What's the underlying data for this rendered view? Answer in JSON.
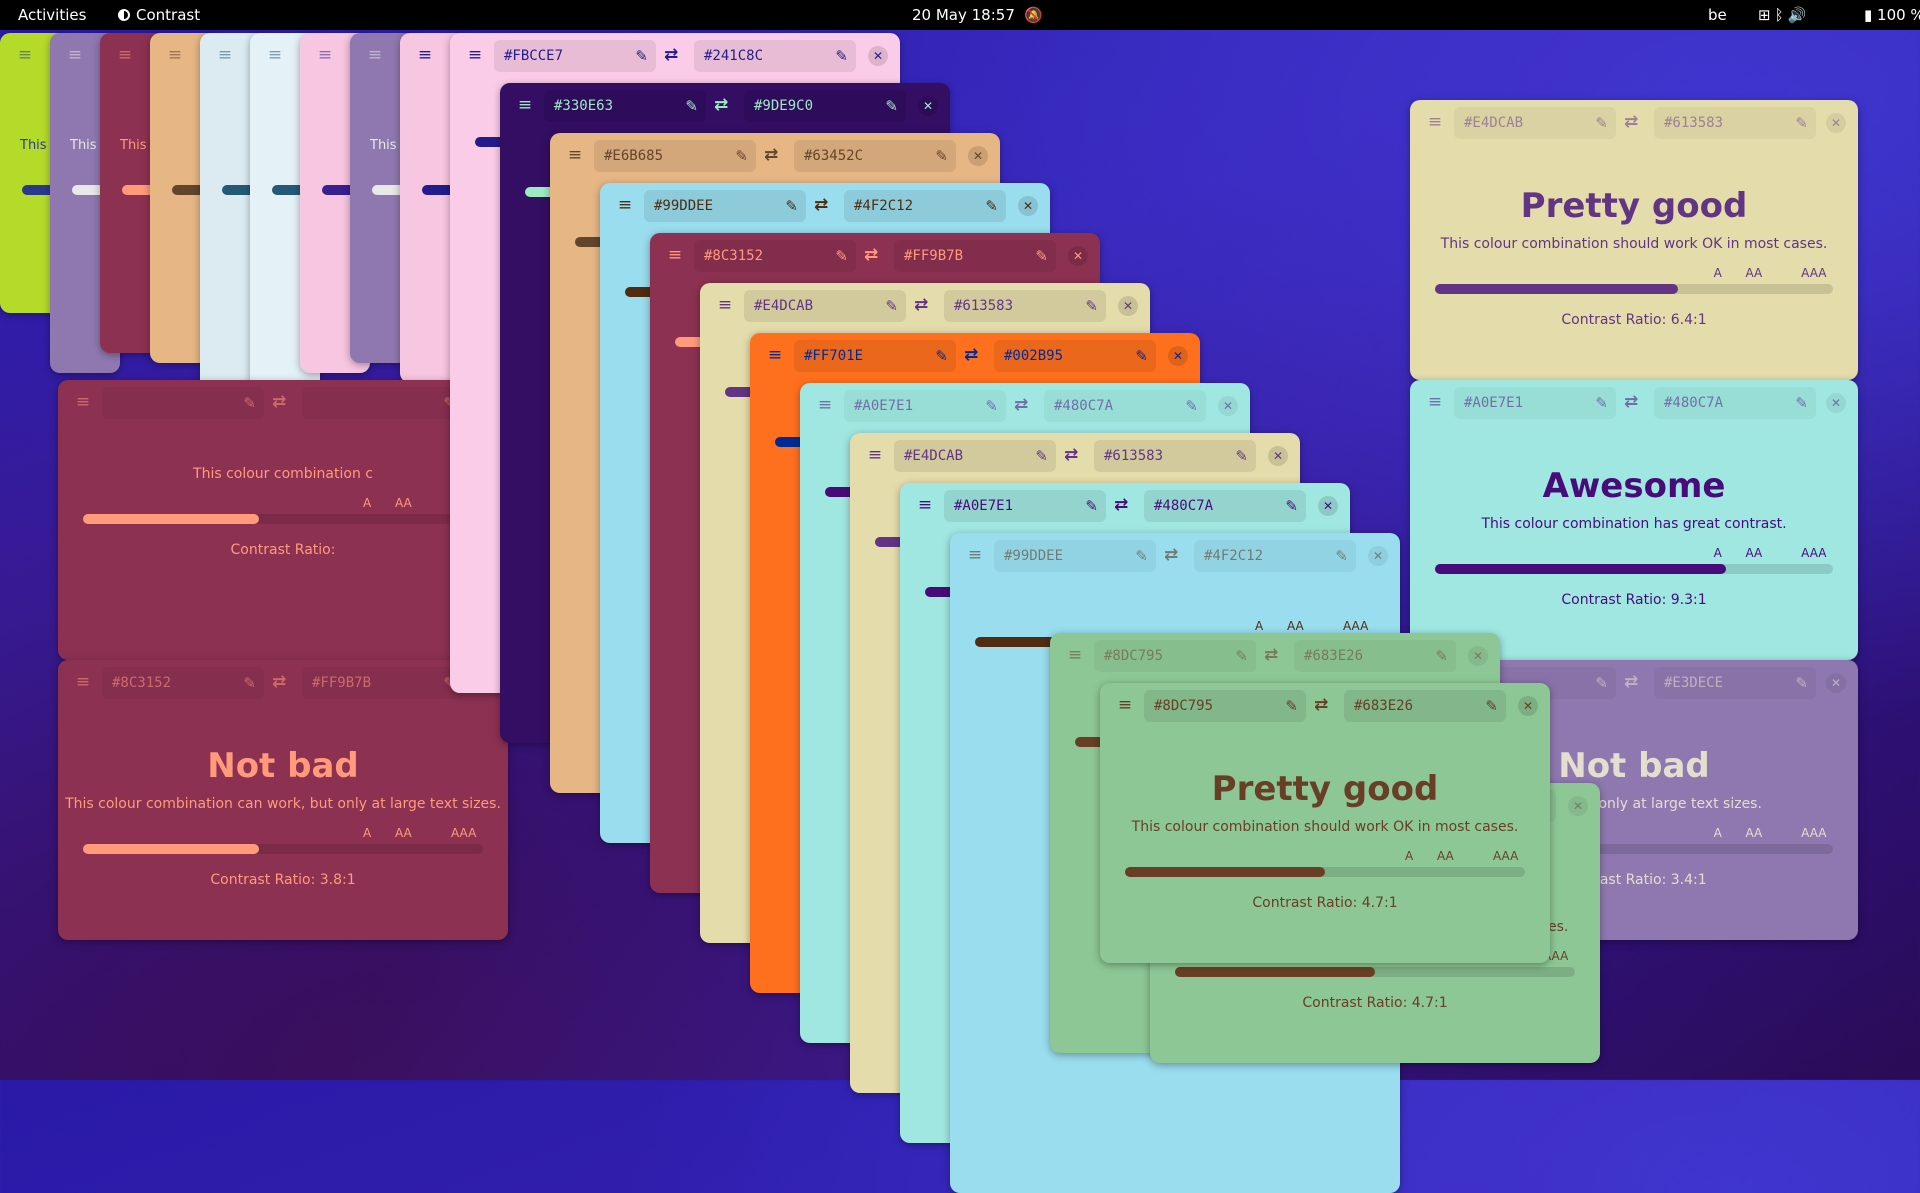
{
  "topbar": {
    "activities": "Activities",
    "app_name": "Contrast",
    "datetime": "20 May 18:57",
    "keyboard_layout": "be",
    "battery": "100 %",
    "icons": [
      "network-icon",
      "bluetooth-icon",
      "volume-icon",
      "battery-icon",
      "notifications-off-icon"
    ]
  },
  "ui": {
    "menu_icon": "≡",
    "swap_icon": "⇄",
    "picker_icon": "✎",
    "close_icon": "✕",
    "level_a": "A",
    "level_aa": "AA",
    "level_aaa": "AAA",
    "stub_text": "This"
  },
  "windows": [
    {
      "bg": "#B5DB2A",
      "fg": "#2A3A8A",
      "fg_hex": "",
      "bg_hex": "",
      "rating": "",
      "desc": "",
      "ratio": "",
      "level": 0.3,
      "dim": true,
      "stub": true
    },
    {
      "bg": "#8F78B0",
      "fg": "#E8E8E8",
      "fg_hex": "",
      "bg_hex": "",
      "rating": "",
      "desc": "",
      "ratio": "",
      "level": 0.3,
      "dim": true,
      "stub": true
    },
    {
      "bg": "#8C3152",
      "fg": "#FF9B7B",
      "fg_hex": "",
      "bg_hex": "",
      "rating": "",
      "desc": "",
      "ratio": "",
      "level": 0.3,
      "dim": true,
      "stub": true
    },
    {
      "bg": "#E6B685",
      "fg": "#63452C",
      "fg_hex": "",
      "bg_hex": "",
      "rating": "",
      "desc": "",
      "ratio": "",
      "level": 0.3,
      "dim": true,
      "stub": false
    },
    {
      "bg": "#DCEBF2",
      "fg": "#245A78",
      "fg_hex": "",
      "bg_hex": "",
      "rating": "",
      "desc": "",
      "ratio": "",
      "level": 0.3,
      "dim": true,
      "stub": false
    },
    {
      "bg": "#E4F2F8",
      "fg": "#245A78",
      "fg_hex": "",
      "bg_hex": "",
      "rating": "",
      "desc": "",
      "ratio": "",
      "level": 0.3,
      "dim": true,
      "stub": false
    },
    {
      "bg": "#F7C6E0",
      "fg": "#3A2090",
      "fg_hex": "",
      "bg_hex": "",
      "rating": "",
      "desc": "",
      "ratio": "",
      "level": 0.3,
      "dim": true,
      "stub": false
    },
    {
      "bg": "#8F78B0",
      "fg": "#E8E8E8",
      "fg_hex": "",
      "bg_hex": "",
      "rating": "",
      "desc": "",
      "ratio": "",
      "level": 0.3,
      "dim": true,
      "stub": true
    },
    {
      "bg": "#F7C6E0",
      "fg": "#241C8C",
      "fg_hex": "",
      "bg_hex": "",
      "rating": "",
      "desc": "",
      "ratio": "",
      "level": 0.3,
      "dim": false,
      "stub": false
    },
    {
      "bg": "#FBCCE7",
      "fg": "#241C8C",
      "fg_hex": "#FBCCE7",
      "bg_hex": "#241C8C",
      "rating": "",
      "desc": "",
      "ratio": "",
      "level": 0.3,
      "dim": false,
      "stub": false
    },
    {
      "bg": "#330E63",
      "fg": "#9DE9C0",
      "fg_hex": "#330E63",
      "bg_hex": "#9DE9C0",
      "rating": "",
      "desc": "",
      "ratio": "",
      "level": 0.3,
      "dim": false,
      "stub": false
    },
    {
      "bg": "#E6B685",
      "fg": "#63452C",
      "fg_hex": "#E6B685",
      "bg_hex": "#63452C",
      "rating": "",
      "desc": "",
      "ratio": "",
      "level": 0.3,
      "dim": false,
      "stub": false
    },
    {
      "bg": "#99DDEE",
      "fg": "#4F2C12",
      "fg_hex": "#99DDEE",
      "bg_hex": "#4F2C12",
      "rating": "",
      "desc": "",
      "ratio": "",
      "level": 0.3,
      "dim": false,
      "stub": false
    },
    {
      "bg": "#8C3152",
      "fg": "#FF9B7B",
      "fg_hex": "#8C3152",
      "bg_hex": "#FF9B7B",
      "rating": "",
      "desc": "",
      "ratio": "",
      "level": 0.3,
      "dim": false,
      "stub": true
    },
    {
      "bg": "#E4DCAB",
      "fg": "#613583",
      "fg_hex": "#E4DCAB",
      "bg_hex": "#613583",
      "rating": "",
      "desc": "",
      "ratio": "",
      "level": 0.3,
      "dim": false,
      "stub": false
    },
    {
      "bg": "#FF701E",
      "fg": "#002B95",
      "fg_hex": "#FF701E",
      "bg_hex": "#002B95",
      "rating": "",
      "desc": "",
      "ratio": "",
      "level": 0.3,
      "dim": false,
      "stub": false
    },
    {
      "bg": "#A0E7E1",
      "fg": "#480C7A",
      "fg_hex": "#A0E7E1",
      "bg_hex": "#480C7A",
      "rating": "",
      "desc": "",
      "ratio": "",
      "level": 0.3,
      "dim": true,
      "stub": true
    },
    {
      "bg": "#E4DCAB",
      "fg": "#613583",
      "fg_hex": "#E4DCAB",
      "bg_hex": "#613583",
      "rating": "",
      "desc": "",
      "ratio": "",
      "level": 0.3,
      "dim": false,
      "stub": false
    },
    {
      "bg": "#A0E7E1",
      "fg": "#480C7A",
      "fg_hex": "#A0E7E1",
      "bg_hex": "#480C7A",
      "rating": "",
      "desc": "",
      "ratio": "",
      "level": 0.3,
      "dim": false,
      "stub": false
    },
    {
      "bg": "#99DDEE",
      "fg": "#4F2C12",
      "fg_hex": "#99DDEE",
      "bg_hex": "#4F2C12",
      "rating": "",
      "desc": "",
      "ratio": "",
      "level": 0.3,
      "dim": true,
      "stub": true
    },
    {
      "bg": "#8DC795",
      "fg": "#683E26",
      "fg_hex": "#8DC795",
      "bg_hex": "#683E26",
      "rating": "",
      "desc": "",
      "ratio": "",
      "level": 0.3,
      "dim": true,
      "stub": false
    },
    {
      "bg": "#8DC795",
      "fg": "#683E26",
      "fg_hex": "#8DC795",
      "bg_hex": "#683E26",
      "rating": "Pretty good",
      "desc": "This colour combination should work OK in most cases.",
      "ratio": "Contrast Ratio: 4.7:1",
      "level": 0.5,
      "dim": false,
      "stub": false
    },
    {
      "bg": "#8DC795",
      "fg": "#683E26",
      "fg_hex": "#8DC795",
      "bg_hex": "#683E26",
      "rating": "Pretty good",
      "desc": "This colour combination should work OK in most cases.",
      "ratio": "Contrast Ratio: 4.7:1",
      "level": 0.5,
      "dim": true,
      "stub": false
    },
    {
      "bg": "#E4DCAB",
      "fg": "#613583",
      "fg_hex": "#E4DCAB",
      "bg_hex": "#613583",
      "rating": "Pretty good",
      "desc": "This colour combination should work OK in most cases.",
      "ratio": "Contrast Ratio: 6.4:1",
      "level": 0.61,
      "dim": true,
      "stub": false
    },
    {
      "bg": "#A0E7E1",
      "fg": "#480C7A",
      "fg_hex": "#A0E7E1",
      "bg_hex": "#480C7A",
      "rating": "Awesome",
      "desc": "This colour combination has great contrast.",
      "ratio": "Contrast Ratio: 9.3:1",
      "level": 0.73,
      "dim": true,
      "stub": false
    },
    {
      "bg": "#8C3152",
      "fg": "#FF9B7B",
      "fg_hex": "#8C3152",
      "bg_hex": "#FF9B7B",
      "rating": "Not bad",
      "desc": "This colour combination can work, but only at large text sizes.",
      "ratio": "Contrast Ratio: 3.8:1",
      "level": 0.44,
      "dim": true,
      "stub": false
    },
    {
      "bg": "#8F78B0",
      "fg": "#E3DECE",
      "fg_hex": "",
      "bg_hex": "#E3DECE",
      "rating": "Not bad",
      "desc": "an work, but only at large text sizes.",
      "ratio": "Contrast Ratio: 3.4:1",
      "level": 0.4,
      "dim": true,
      "stub": false
    },
    {
      "bg": "#8C3152",
      "fg": "#FF9B7B",
      "fg_hex": "",
      "bg_hex": "",
      "rating": "",
      "desc": "This colour combination c",
      "ratio": "Contrast Ratio:",
      "level": 0.44,
      "dim": true,
      "stub": false
    }
  ]
}
